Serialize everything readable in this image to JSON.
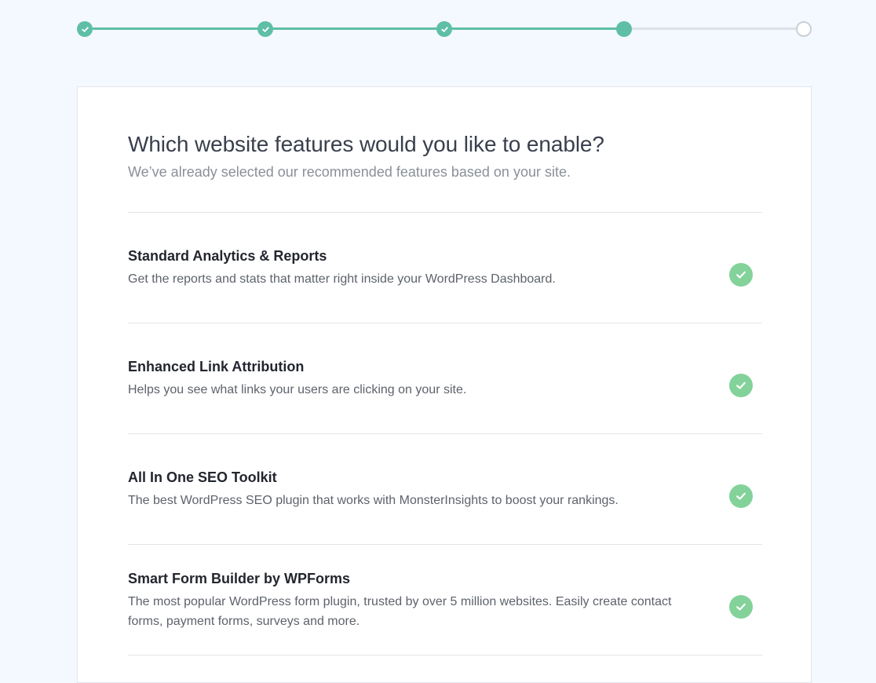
{
  "colors": {
    "accent": "#5ebfa6",
    "check": "#83d29a",
    "track_inactive": "#dde3ea",
    "page_background": "#f4f8ff"
  },
  "stepper": {
    "steps": [
      {
        "state": "complete",
        "icon": "check-icon"
      },
      {
        "state": "complete",
        "icon": "check-icon"
      },
      {
        "state": "complete",
        "icon": "check-icon"
      },
      {
        "state": "current"
      },
      {
        "state": "upcoming"
      }
    ]
  },
  "header": {
    "title": "Which website features would you like to enable?",
    "subtitle": "We’ve already selected our recommended features based on your site."
  },
  "features": [
    {
      "title": "Standard Analytics & Reports",
      "description": "Get the reports and stats that matter right inside your WordPress Dashboard.",
      "selected": true,
      "icon": "check-circle-icon"
    },
    {
      "title": "Enhanced Link Attribution",
      "description": "Helps you see what links your users are clicking on your site.",
      "selected": true,
      "icon": "check-circle-icon"
    },
    {
      "title": "All In One SEO Toolkit",
      "description": "The best WordPress SEO plugin that works with MonsterInsights to boost your rankings.",
      "selected": true,
      "icon": "check-circle-icon"
    },
    {
      "title": "Smart Form Builder by WPForms",
      "description": "The most popular WordPress form plugin, trusted by over 5 million websites. Easily create contact forms, payment forms, surveys and more.",
      "selected": true,
      "icon": "check-circle-icon"
    }
  ]
}
